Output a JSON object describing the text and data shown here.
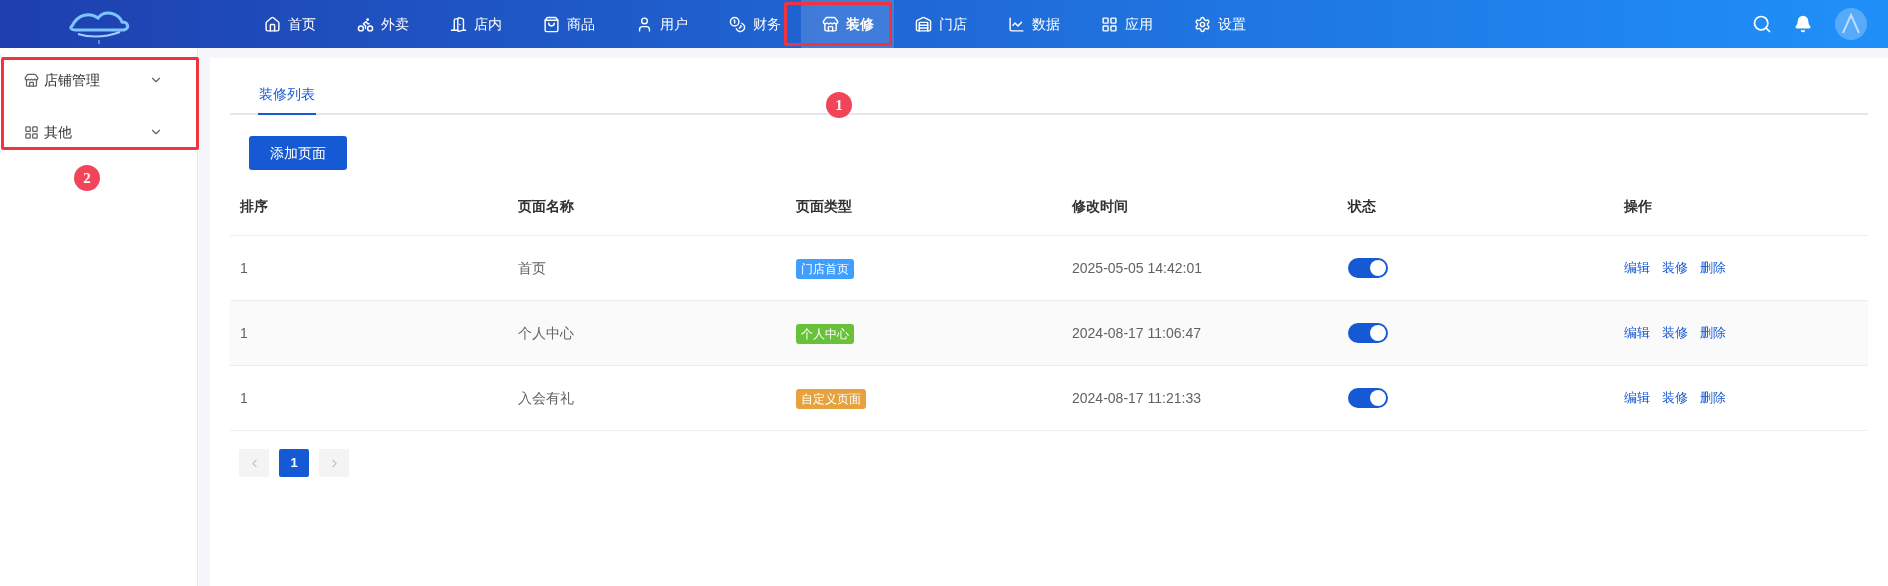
{
  "nav": [
    {
      "label": "首页",
      "selected": false
    },
    {
      "label": "外卖",
      "selected": false
    },
    {
      "label": "店内",
      "selected": false
    },
    {
      "label": "商品",
      "selected": false
    },
    {
      "label": "用户",
      "selected": false
    },
    {
      "label": "财务",
      "selected": false
    },
    {
      "label": "装修",
      "selected": true
    },
    {
      "label": "门店",
      "selected": false
    },
    {
      "label": "数据",
      "selected": false
    },
    {
      "label": "应用",
      "selected": false
    },
    {
      "label": "设置",
      "selected": false
    }
  ],
  "sidebar": {
    "items": [
      {
        "label": "店铺管理",
        "expanded": false
      },
      {
        "label": "其他",
        "expanded": false
      }
    ]
  },
  "tabs": [
    {
      "label": "装修列表",
      "selected": true
    }
  ],
  "add_button": "添加页面",
  "table": {
    "columns": [
      "排序",
      "页面名称",
      "页面类型",
      "修改时间",
      "状态",
      "操作"
    ],
    "rows": [
      {
        "order": "1",
        "name": "首页",
        "type": "门店首页",
        "color": "#409eff",
        "modified": "2025-05-05 14:42:01",
        "on": true,
        "actions": [
          "编辑",
          "装修",
          "删除"
        ]
      },
      {
        "order": "1",
        "name": "个人中心",
        "type": "个人中心",
        "color": "#67c23a",
        "modified": "2024-08-17 11:06:47",
        "on": true,
        "actions": [
          "编辑",
          "装修",
          "删除"
        ]
      },
      {
        "order": "1",
        "name": "入会有礼",
        "type": "自定义页面",
        "color": "#e6a23c",
        "modified": "2024-08-17 11:21:33",
        "on": true,
        "actions": [
          "编辑",
          "装修",
          "删除"
        ]
      }
    ]
  },
  "pagination": {
    "pages": [
      {
        "label": "1",
        "selected": true
      }
    ]
  },
  "annotations": [
    {
      "label": "1"
    },
    {
      "label": "2"
    }
  ]
}
